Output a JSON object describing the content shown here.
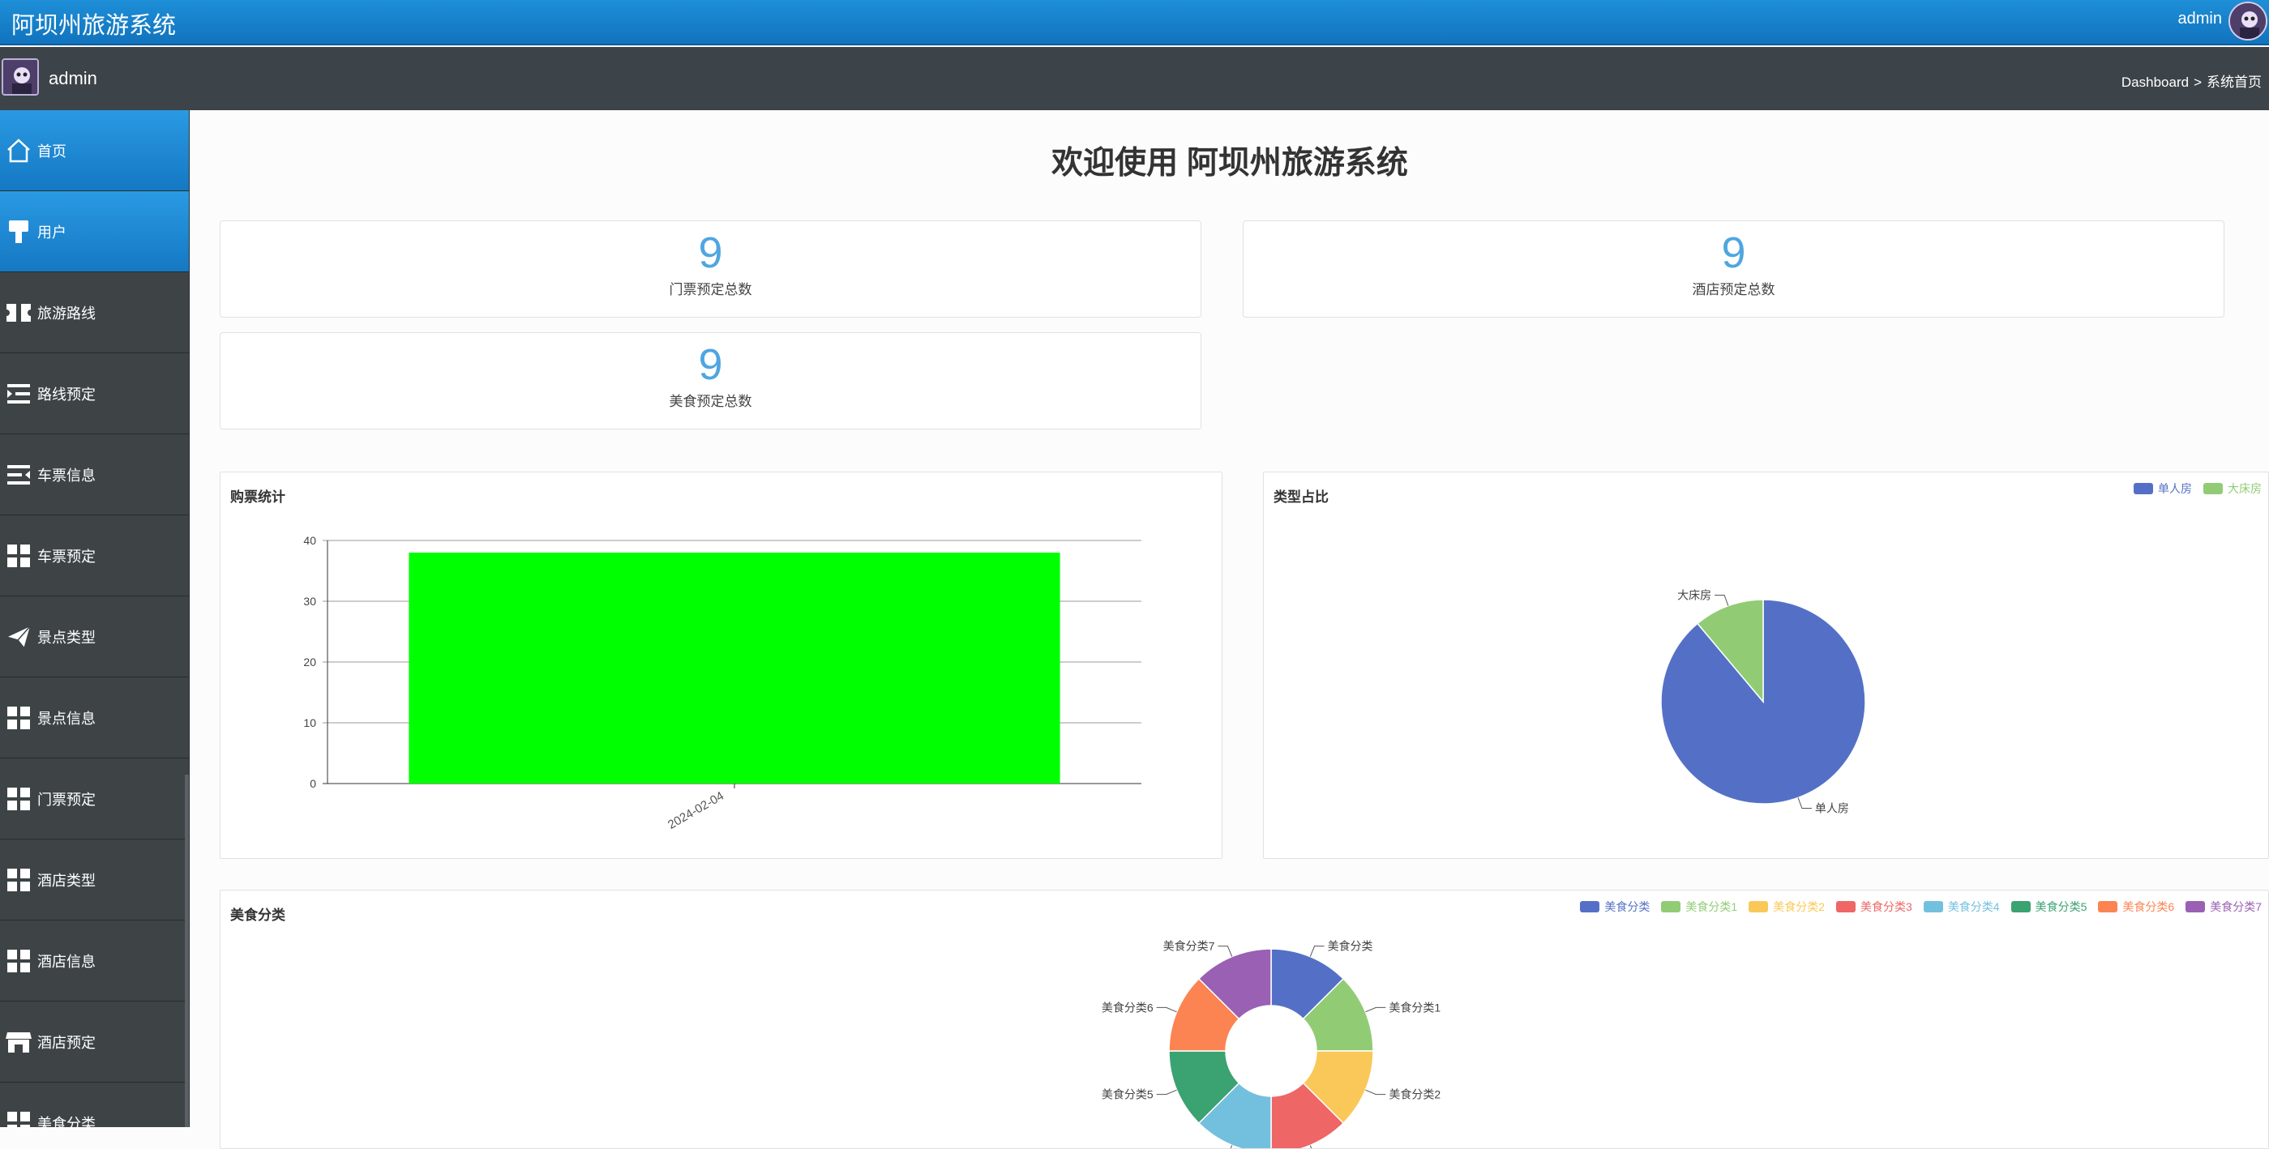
{
  "header": {
    "app_title": "阿坝州旅游系统",
    "user": "admin"
  },
  "subbar": {
    "user": "admin",
    "breadcrumb": [
      "Dashboard",
      ">",
      "系统首页"
    ]
  },
  "sidebar": {
    "items": [
      {
        "label": "首页",
        "icon": "home-icon",
        "active": true
      },
      {
        "label": "用户",
        "icon": "paint-brush-icon",
        "active": true
      },
      {
        "label": "旅游路线",
        "icon": "ticket-icon"
      },
      {
        "label": "路线预定",
        "icon": "indent-icon"
      },
      {
        "label": "车票信息",
        "icon": "outdent-icon"
      },
      {
        "label": "车票预定",
        "icon": "grid-icon"
      },
      {
        "label": "景点类型",
        "icon": "paper-plane-icon"
      },
      {
        "label": "景点信息",
        "icon": "grid-icon"
      },
      {
        "label": "门票预定",
        "icon": "grid-icon"
      },
      {
        "label": "酒店类型",
        "icon": "grid-icon"
      },
      {
        "label": "酒店信息",
        "icon": "grid-icon"
      },
      {
        "label": "酒店预定",
        "icon": "store-icon"
      },
      {
        "label": "美食分类",
        "icon": "grid-icon"
      }
    ]
  },
  "main": {
    "welcome": "欢迎使用 阿坝州旅游系统",
    "stats": [
      {
        "value": "9",
        "label": "门票预定总数"
      },
      {
        "value": "9",
        "label": "酒店预定总数"
      },
      {
        "value": "9",
        "label": "美食预定总数"
      }
    ],
    "panels": {
      "ticket_title": "购票统计",
      "type_title": "类型占比",
      "food_title": "美食分类"
    }
  },
  "chart_data": [
    {
      "type": "bar",
      "title": "购票统计",
      "categories": [
        "2024-02-04"
      ],
      "values": [
        38
      ],
      "ylim": [
        0,
        40
      ],
      "yticks": [
        0,
        10,
        20,
        30,
        40
      ],
      "color": "#00ff00"
    },
    {
      "type": "pie",
      "title": "类型占比",
      "labels": [
        "单人房",
        "大床房"
      ],
      "values": [
        8,
        1
      ],
      "colors": [
        "#5470c6",
        "#91cc75"
      ],
      "legend": "top-right"
    },
    {
      "type": "pie",
      "title": "美食分类",
      "donut": true,
      "labels": [
        "美食分类",
        "美食分类1",
        "美食分类2",
        "美食分类3",
        "美食分类4",
        "美食分类5",
        "美食分类6",
        "美食分类7"
      ],
      "values": [
        1,
        1,
        1,
        1,
        1,
        1,
        1,
        1
      ],
      "colors": [
        "#5470c6",
        "#91cc75",
        "#fac858",
        "#ee6666",
        "#73c0de",
        "#3ba272",
        "#fc8452",
        "#9a60b4"
      ],
      "legend": "top-right"
    }
  ]
}
